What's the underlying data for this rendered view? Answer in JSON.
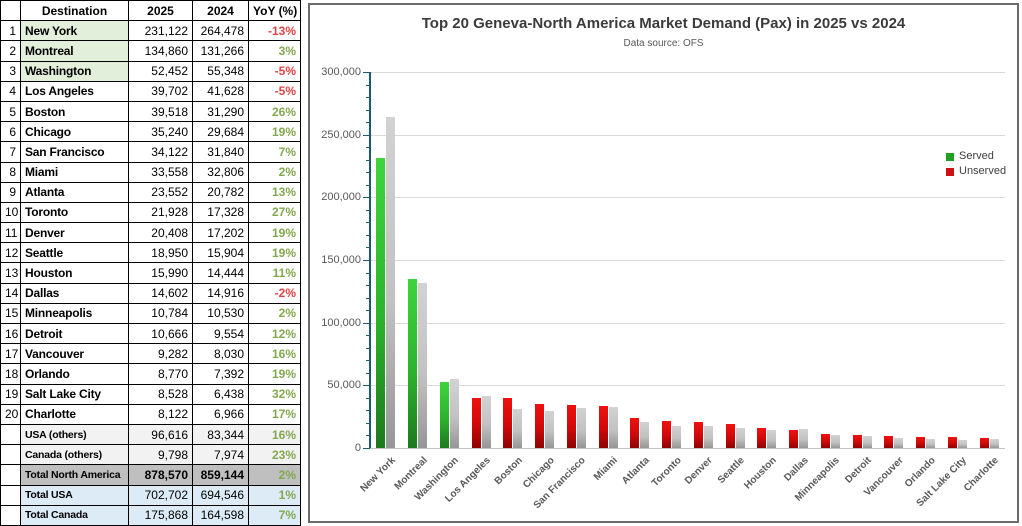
{
  "table": {
    "headers": {
      "destination": "Destination",
      "y2025": "2025",
      "y2024": "2024",
      "yoy": "YoY (%)"
    },
    "rows": [
      {
        "rank": "1",
        "destination": "New York",
        "v2025": "231,122",
        "v2024": "264,478",
        "yoy": "-13%",
        "served": true
      },
      {
        "rank": "2",
        "destination": "Montreal",
        "v2025": "134,860",
        "v2024": "131,266",
        "yoy": "3%",
        "served": true
      },
      {
        "rank": "3",
        "destination": "Washington",
        "v2025": "52,452",
        "v2024": "55,348",
        "yoy": "-5%",
        "served": true
      },
      {
        "rank": "4",
        "destination": "Los Angeles",
        "v2025": "39,702",
        "v2024": "41,628",
        "yoy": "-5%",
        "served": false
      },
      {
        "rank": "5",
        "destination": "Boston",
        "v2025": "39,518",
        "v2024": "31,290",
        "yoy": "26%",
        "served": false
      },
      {
        "rank": "6",
        "destination": "Chicago",
        "v2025": "35,240",
        "v2024": "29,684",
        "yoy": "19%",
        "served": false
      },
      {
        "rank": "7",
        "destination": "San Francisco",
        "v2025": "34,122",
        "v2024": "31,840",
        "yoy": "7%",
        "served": false
      },
      {
        "rank": "8",
        "destination": "Miami",
        "v2025": "33,558",
        "v2024": "32,806",
        "yoy": "2%",
        "served": false
      },
      {
        "rank": "9",
        "destination": "Atlanta",
        "v2025": "23,552",
        "v2024": "20,782",
        "yoy": "13%",
        "served": false
      },
      {
        "rank": "10",
        "destination": "Toronto",
        "v2025": "21,928",
        "v2024": "17,328",
        "yoy": "27%",
        "served": false
      },
      {
        "rank": "11",
        "destination": "Denver",
        "v2025": "20,408",
        "v2024": "17,202",
        "yoy": "19%",
        "served": false
      },
      {
        "rank": "12",
        "destination": "Seattle",
        "v2025": "18,950",
        "v2024": "15,904",
        "yoy": "19%",
        "served": false
      },
      {
        "rank": "13",
        "destination": "Houston",
        "v2025": "15,990",
        "v2024": "14,444",
        "yoy": "11%",
        "served": false
      },
      {
        "rank": "14",
        "destination": "Dallas",
        "v2025": "14,602",
        "v2024": "14,916",
        "yoy": "-2%",
        "served": false
      },
      {
        "rank": "15",
        "destination": "Minneapolis",
        "v2025": "10,784",
        "v2024": "10,530",
        "yoy": "2%",
        "served": false
      },
      {
        "rank": "16",
        "destination": "Detroit",
        "v2025": "10,666",
        "v2024": "9,554",
        "yoy": "12%",
        "served": false
      },
      {
        "rank": "17",
        "destination": "Vancouver",
        "v2025": "9,282",
        "v2024": "8,030",
        "yoy": "16%",
        "served": false
      },
      {
        "rank": "18",
        "destination": "Orlando",
        "v2025": "8,770",
        "v2024": "7,392",
        "yoy": "19%",
        "served": false
      },
      {
        "rank": "19",
        "destination": "Salt Lake City",
        "v2025": "8,528",
        "v2024": "6,438",
        "yoy": "32%",
        "served": false
      },
      {
        "rank": "20",
        "destination": "Charlotte",
        "v2025": "8,122",
        "v2024": "6,966",
        "yoy": "17%",
        "served": false
      }
    ],
    "summary_rows": [
      {
        "label": "USA (others)",
        "v2025": "96,616",
        "v2024": "83,344",
        "yoy": "16%",
        "style": "others"
      },
      {
        "label": "Canada (others)",
        "v2025": "9,798",
        "v2024": "7,974",
        "yoy": "23%",
        "style": "others"
      },
      {
        "label": "Total North America",
        "v2025": "878,570",
        "v2024": "859,144",
        "yoy": "2%",
        "style": "total-na"
      },
      {
        "label": "Total USA",
        "v2025": "702,702",
        "v2024": "694,546",
        "yoy": "1%",
        "style": "total-blue"
      },
      {
        "label": "Total Canada",
        "v2025": "175,868",
        "v2024": "164,598",
        "yoy": "7%",
        "style": "total-blue"
      }
    ],
    "colors": {
      "header_bg": "#d9d9d9",
      "served_bg": "#e2efda",
      "others_bg": "#f2f2f2",
      "total_na_bg": "#bfbfbf",
      "total_blue_bg": "#ddebf7",
      "yoy_positive": "#82a84e",
      "yoy_negative": "#e04444"
    }
  },
  "chart_data": {
    "type": "bar",
    "title": "Top 20 Geneva-North America Market Demand (Pax) in 2025 vs 2024",
    "subtitle": "Data source: OFS",
    "categories": [
      "New York",
      "Montreal",
      "Washington",
      "Los Angeles",
      "Boston",
      "Chicago",
      "San Francisco",
      "Miami",
      "Atlanta",
      "Toronto",
      "Denver",
      "Seattle",
      "Houston",
      "Dallas",
      "Minneapolis",
      "Detroit",
      "Vancouver",
      "Orlando",
      "Salt Lake City",
      "Charlotte"
    ],
    "series": [
      {
        "name": "2025",
        "values": [
          231122,
          134860,
          52452,
          39702,
          39518,
          35240,
          34122,
          33558,
          23552,
          21928,
          20408,
          18950,
          15990,
          14602,
          10784,
          10666,
          9282,
          8770,
          8528,
          8122
        ]
      },
      {
        "name": "2024",
        "values": [
          264478,
          131266,
          55348,
          41628,
          31290,
          29684,
          31840,
          32806,
          20782,
          17328,
          17202,
          15904,
          14444,
          14916,
          10530,
          9554,
          8030,
          7392,
          6438,
          6966
        ]
      }
    ],
    "served": [
      true,
      true,
      true,
      false,
      false,
      false,
      false,
      false,
      false,
      false,
      false,
      false,
      false,
      false,
      false,
      false,
      false,
      false,
      false,
      false
    ],
    "legend": [
      {
        "label": "Served",
        "color": "#21a121"
      },
      {
        "label": "Unserved",
        "color": "#ce1212"
      }
    ],
    "legend_position": "right",
    "grid": true,
    "xlabel": "",
    "ylabel": "",
    "ylim": [
      0,
      300000
    ],
    "ytick_step": 50000,
    "yminor_step": 10000,
    "colors": {
      "served_bar": "#2db32d",
      "unserved_bar": "#cf0808",
      "prev_year_bar": "#bfbfbf",
      "axis": "#1c5a6e",
      "gridline": "#d9d9d9",
      "labels": "#595959"
    }
  }
}
